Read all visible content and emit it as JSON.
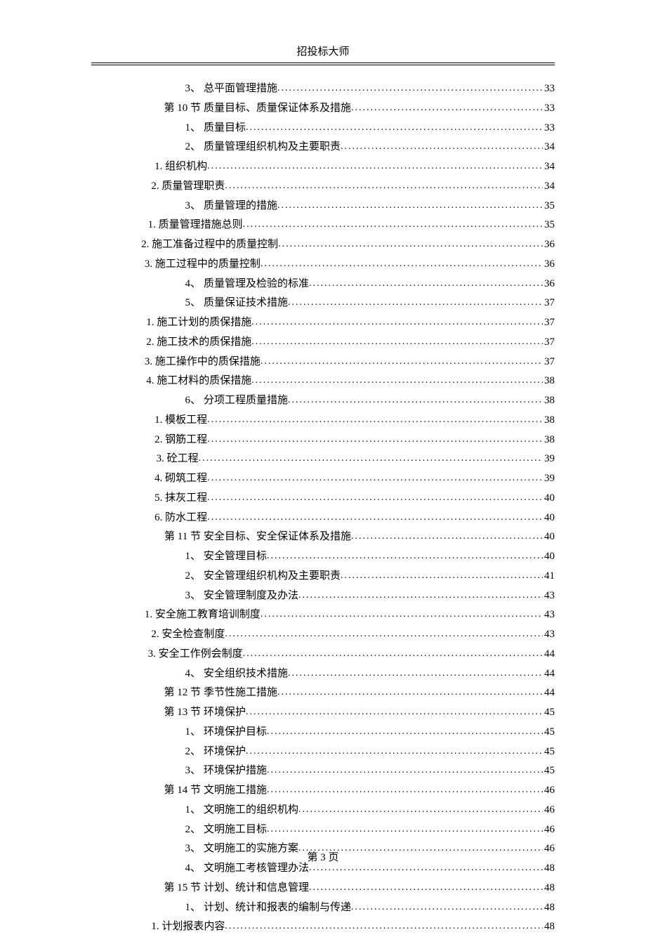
{
  "header": {
    "title": "招投标大师"
  },
  "footer": {
    "page_label": "第 3 页"
  },
  "toc": [
    {
      "level": "item",
      "label": "3、",
      "title": "总平面管理措施",
      "page": "33"
    },
    {
      "level": "section",
      "label": "第 10 节",
      "title": "质量目标、质量保证体系及措施",
      "page": "33"
    },
    {
      "level": "item",
      "label": "1、",
      "title": "质量目标",
      "page": "33"
    },
    {
      "level": "item",
      "label": "2、",
      "title": "质量管理组织机构及主要职责",
      "page": "34"
    },
    {
      "level": "sub",
      "label": "",
      "title": "1. 组织机构",
      "page": "34"
    },
    {
      "level": "sub",
      "label": "",
      "title": "2. 质量管理职责",
      "page": "34"
    },
    {
      "level": "item",
      "label": "3、",
      "title": "质量管理的措施",
      "page": "35"
    },
    {
      "level": "sub",
      "label": "",
      "title": "1. 质量管理措施总则",
      "page": "35"
    },
    {
      "level": "sub",
      "label": "",
      "title": "2. 施工准备过程中的质量控制",
      "page": "36"
    },
    {
      "level": "sub",
      "label": "",
      "title": "3. 施工过程中的质量控制",
      "page": "36"
    },
    {
      "level": "item",
      "label": "4、",
      "title": "质量管理及检验的标准",
      "page": "36"
    },
    {
      "level": "item",
      "label": "5、",
      "title": "质量保证技术措施",
      "page": "37"
    },
    {
      "level": "sub",
      "label": "",
      "title": "1. 施工计划的质保措施",
      "page": "37"
    },
    {
      "level": "sub",
      "label": "",
      "title": "2. 施工技术的质保措施",
      "page": "37"
    },
    {
      "level": "sub",
      "label": "",
      "title": "3. 施工操作中的质保措施",
      "page": "37"
    },
    {
      "level": "sub",
      "label": "",
      "title": "4. 施工材料的质保措施",
      "page": "38"
    },
    {
      "level": "item",
      "label": "6、",
      "title": "分项工程质量措施",
      "page": "38"
    },
    {
      "level": "sub",
      "label": "",
      "title": "1. 模板工程",
      "page": "38"
    },
    {
      "level": "sub",
      "label": "",
      "title": "2. 钢筋工程",
      "page": "38"
    },
    {
      "level": "sub",
      "label": "",
      "title": "3. 砼工程",
      "page": "39"
    },
    {
      "level": "sub",
      "label": "",
      "title": "4. 砌筑工程",
      "page": "39"
    },
    {
      "level": "sub",
      "label": "",
      "title": "5. 抹灰工程",
      "page": "40"
    },
    {
      "level": "sub",
      "label": "",
      "title": "6. 防水工程",
      "page": "40"
    },
    {
      "level": "section",
      "label": "第 11 节",
      "title": "安全目标、安全保证体系及措施",
      "page": "40"
    },
    {
      "level": "item",
      "label": "1、",
      "title": "安全管理目标",
      "page": "40"
    },
    {
      "level": "item",
      "label": "2、",
      "title": "安全管理组织机构及主要职责",
      "page": "41"
    },
    {
      "level": "item",
      "label": "3、",
      "title": "安全管理制度及办法",
      "page": "43"
    },
    {
      "level": "sub",
      "label": "",
      "title": "1. 安全施工教育培训制度",
      "page": "43"
    },
    {
      "level": "sub",
      "label": "",
      "title": "2. 安全检查制度",
      "page": "43"
    },
    {
      "level": "sub",
      "label": "",
      "title": "3. 安全工作例会制度",
      "page": "44"
    },
    {
      "level": "item",
      "label": "4、",
      "title": "安全组织技术措施",
      "page": "44"
    },
    {
      "level": "section",
      "label": "第 12 节",
      "title": "季节性施工措施",
      "page": "44"
    },
    {
      "level": "section",
      "label": "第 13 节",
      "title": "环境保护",
      "page": "45"
    },
    {
      "level": "item",
      "label": "1、",
      "title": "环境保护目标",
      "page": "45"
    },
    {
      "level": "item",
      "label": "2、",
      "title": "环境保护",
      "page": "45"
    },
    {
      "level": "item",
      "label": "3、",
      "title": "环境保护措施",
      "page": "45"
    },
    {
      "level": "section",
      "label": "第 14 节",
      "title": "文明施工措施",
      "page": "46"
    },
    {
      "level": "item",
      "label": "1、",
      "title": "文明施工的组织机构",
      "page": "46"
    },
    {
      "level": "item",
      "label": "2、",
      "title": "文明施工目标",
      "page": "46"
    },
    {
      "level": "item",
      "label": "3、",
      "title": "文明施工的实施方案",
      "page": "46"
    },
    {
      "level": "item",
      "label": "4、",
      "title": "文明施工考核管理办法",
      "page": "48"
    },
    {
      "level": "section",
      "label": "第 15 节",
      "title": "计划、统计和信息管理",
      "page": "48"
    },
    {
      "level": "item",
      "label": "1、",
      "title": "计划、统计和报表的编制与传递",
      "page": "48"
    },
    {
      "level": "sub",
      "label": "",
      "title": "1. 计划报表内容",
      "page": "48"
    }
  ]
}
